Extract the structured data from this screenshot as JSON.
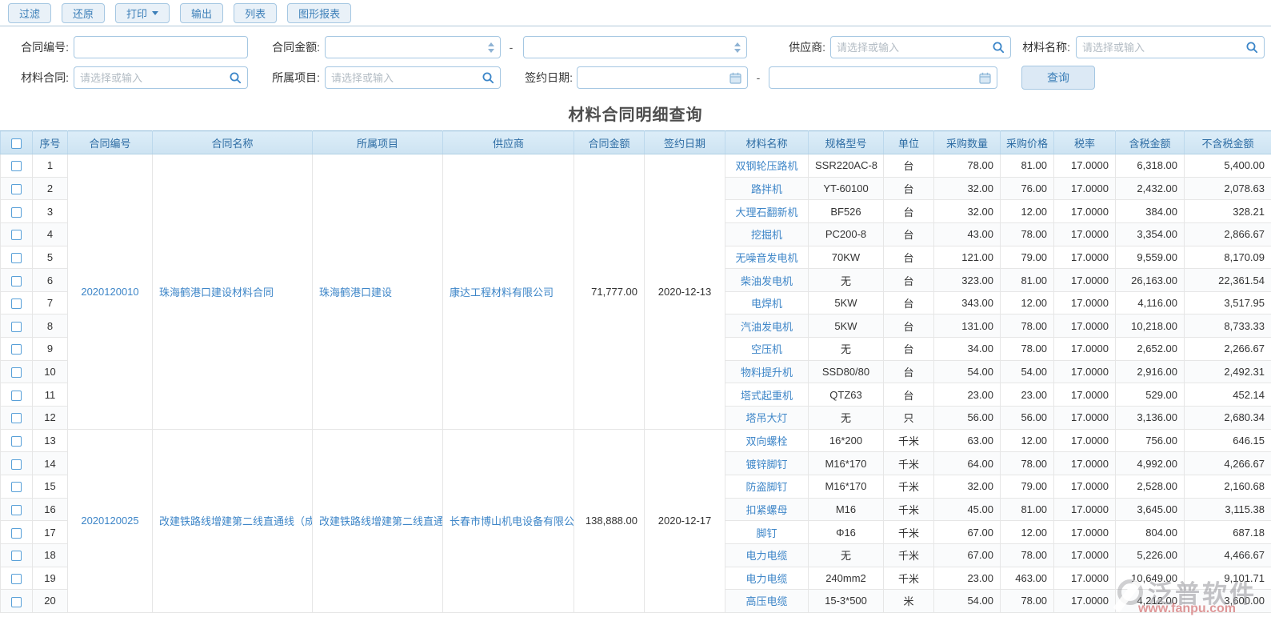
{
  "toolbar": {
    "buttons": [
      {
        "label": "过滤"
      },
      {
        "label": "还原"
      },
      {
        "label": "打印",
        "dropdown": true
      },
      {
        "label": "输出"
      },
      {
        "label": "列表"
      },
      {
        "label": "图形报表"
      }
    ]
  },
  "filters": {
    "contract_no": {
      "label": "合同编号:"
    },
    "contract_amount": {
      "label": "合同金额:"
    },
    "supplier": {
      "label": "供应商:",
      "placeholder": "请选择或输入"
    },
    "material_name": {
      "label": "材料名称:",
      "placeholder": "请选择或输入"
    },
    "material_contract": {
      "label": "材料合同:",
      "placeholder": "请选择或输入"
    },
    "project": {
      "label": "所属项目:",
      "placeholder": "请选择或输入"
    },
    "sign_date": {
      "label": "签约日期:"
    },
    "range_separator": "-",
    "query_button": "查询"
  },
  "title": "材料合同明细查询",
  "table": {
    "headers": [
      "序号",
      "合同编号",
      "合同名称",
      "所属项目",
      "供应商",
      "合同金额",
      "签约日期",
      "材料名称",
      "规格型号",
      "单位",
      "采购数量",
      "采购价格",
      "税率",
      "含税金额",
      "不含税金额"
    ],
    "contracts": [
      {
        "contract_no": "2020120010",
        "contract_name": "珠海鹤港口建设材料合同",
        "project": "珠海鹤港口建设",
        "supplier": "康达工程材料有限公司",
        "amount": "71,777.00",
        "sign_date": "2020-12-13",
        "materials": [
          {
            "name": "双钢轮压路机",
            "spec": "SSR220AC-8",
            "unit": "台",
            "qty": "78.00",
            "price": "81.00",
            "tax_rate": "17.0000",
            "tax_amount": "6,318.00",
            "net_amount": "5,400.00"
          },
          {
            "name": "路拌机",
            "spec": "YT-60100",
            "unit": "台",
            "qty": "32.00",
            "price": "76.00",
            "tax_rate": "17.0000",
            "tax_amount": "2,432.00",
            "net_amount": "2,078.63"
          },
          {
            "name": "大理石翻新机",
            "spec": "BF526",
            "unit": "台",
            "qty": "32.00",
            "price": "12.00",
            "tax_rate": "17.0000",
            "tax_amount": "384.00",
            "net_amount": "328.21"
          },
          {
            "name": "挖掘机",
            "spec": "PC200-8",
            "unit": "台",
            "qty": "43.00",
            "price": "78.00",
            "tax_rate": "17.0000",
            "tax_amount": "3,354.00",
            "net_amount": "2,866.67"
          },
          {
            "name": "无噪音发电机",
            "spec": "70KW",
            "unit": "台",
            "qty": "121.00",
            "price": "79.00",
            "tax_rate": "17.0000",
            "tax_amount": "9,559.00",
            "net_amount": "8,170.09"
          },
          {
            "name": "柴油发电机",
            "spec": "无",
            "unit": "台",
            "qty": "323.00",
            "price": "81.00",
            "tax_rate": "17.0000",
            "tax_amount": "26,163.00",
            "net_amount": "22,361.54"
          },
          {
            "name": "电焊机",
            "spec": "5KW",
            "unit": "台",
            "qty": "343.00",
            "price": "12.00",
            "tax_rate": "17.0000",
            "tax_amount": "4,116.00",
            "net_amount": "3,517.95"
          },
          {
            "name": "汽油发电机",
            "spec": "5KW",
            "unit": "台",
            "qty": "131.00",
            "price": "78.00",
            "tax_rate": "17.0000",
            "tax_amount": "10,218.00",
            "net_amount": "8,733.33"
          },
          {
            "name": "空压机",
            "spec": "无",
            "unit": "台",
            "qty": "34.00",
            "price": "78.00",
            "tax_rate": "17.0000",
            "tax_amount": "2,652.00",
            "net_amount": "2,266.67"
          },
          {
            "name": "物料提升机",
            "spec": "SSD80/80",
            "unit": "台",
            "qty": "54.00",
            "price": "54.00",
            "tax_rate": "17.0000",
            "tax_amount": "2,916.00",
            "net_amount": "2,492.31"
          },
          {
            "name": "塔式起重机",
            "spec": "QTZ63",
            "unit": "台",
            "qty": "23.00",
            "price": "23.00",
            "tax_rate": "17.0000",
            "tax_amount": "529.00",
            "net_amount": "452.14"
          },
          {
            "name": "塔吊大灯",
            "spec": "无",
            "unit": "只",
            "qty": "56.00",
            "price": "56.00",
            "tax_rate": "17.0000",
            "tax_amount": "3,136.00",
            "net_amount": "2,680.34"
          }
        ]
      },
      {
        "contract_no": "2020120025",
        "contract_name": "改建铁路线增建第二线直通线（成",
        "project": "改建铁路线增建第二线直通",
        "supplier": "长春市博山机电设备有限公",
        "amount": "138,888.00",
        "sign_date": "2020-12-17",
        "materials": [
          {
            "name": "双向螺栓",
            "spec": "16*200",
            "unit": "千米",
            "qty": "63.00",
            "price": "12.00",
            "tax_rate": "17.0000",
            "tax_amount": "756.00",
            "net_amount": "646.15"
          },
          {
            "name": "镀锌脚钉",
            "spec": "M16*170",
            "unit": "千米",
            "qty": "64.00",
            "price": "78.00",
            "tax_rate": "17.0000",
            "tax_amount": "4,992.00",
            "net_amount": "4,266.67"
          },
          {
            "name": "防盗脚钉",
            "spec": "M16*170",
            "unit": "千米",
            "qty": "32.00",
            "price": "79.00",
            "tax_rate": "17.0000",
            "tax_amount": "2,528.00",
            "net_amount": "2,160.68"
          },
          {
            "name": "扣紧螺母",
            "spec": "M16",
            "unit": "千米",
            "qty": "45.00",
            "price": "81.00",
            "tax_rate": "17.0000",
            "tax_amount": "3,645.00",
            "net_amount": "3,115.38"
          },
          {
            "name": "脚钉",
            "spec": "Φ16",
            "unit": "千米",
            "qty": "67.00",
            "price": "12.00",
            "tax_rate": "17.0000",
            "tax_amount": "804.00",
            "net_amount": "687.18"
          },
          {
            "name": "电力电缆",
            "spec": "无",
            "unit": "千米",
            "qty": "67.00",
            "price": "78.00",
            "tax_rate": "17.0000",
            "tax_amount": "5,226.00",
            "net_amount": "4,466.67"
          },
          {
            "name": "电力电缆",
            "spec": "240mm2",
            "unit": "千米",
            "qty": "23.00",
            "price": "463.00",
            "tax_rate": "17.0000",
            "tax_amount": "10,649.00",
            "net_amount": "9,101.71"
          },
          {
            "name": "高压电缆",
            "spec": "15-3*500",
            "unit": "米",
            "qty": "54.00",
            "price": "78.00",
            "tax_rate": "17.0000",
            "tax_amount": "4,212.00",
            "net_amount": "3,600.00"
          }
        ]
      }
    ]
  },
  "watermark": {
    "brand": "泛普软件",
    "url": "www.fanpu.com"
  },
  "colors": {
    "accent": "#3c7fb8",
    "link": "#3e86c8",
    "header_bg": "#d7e9f5",
    "header_text": "#2e6da4"
  }
}
